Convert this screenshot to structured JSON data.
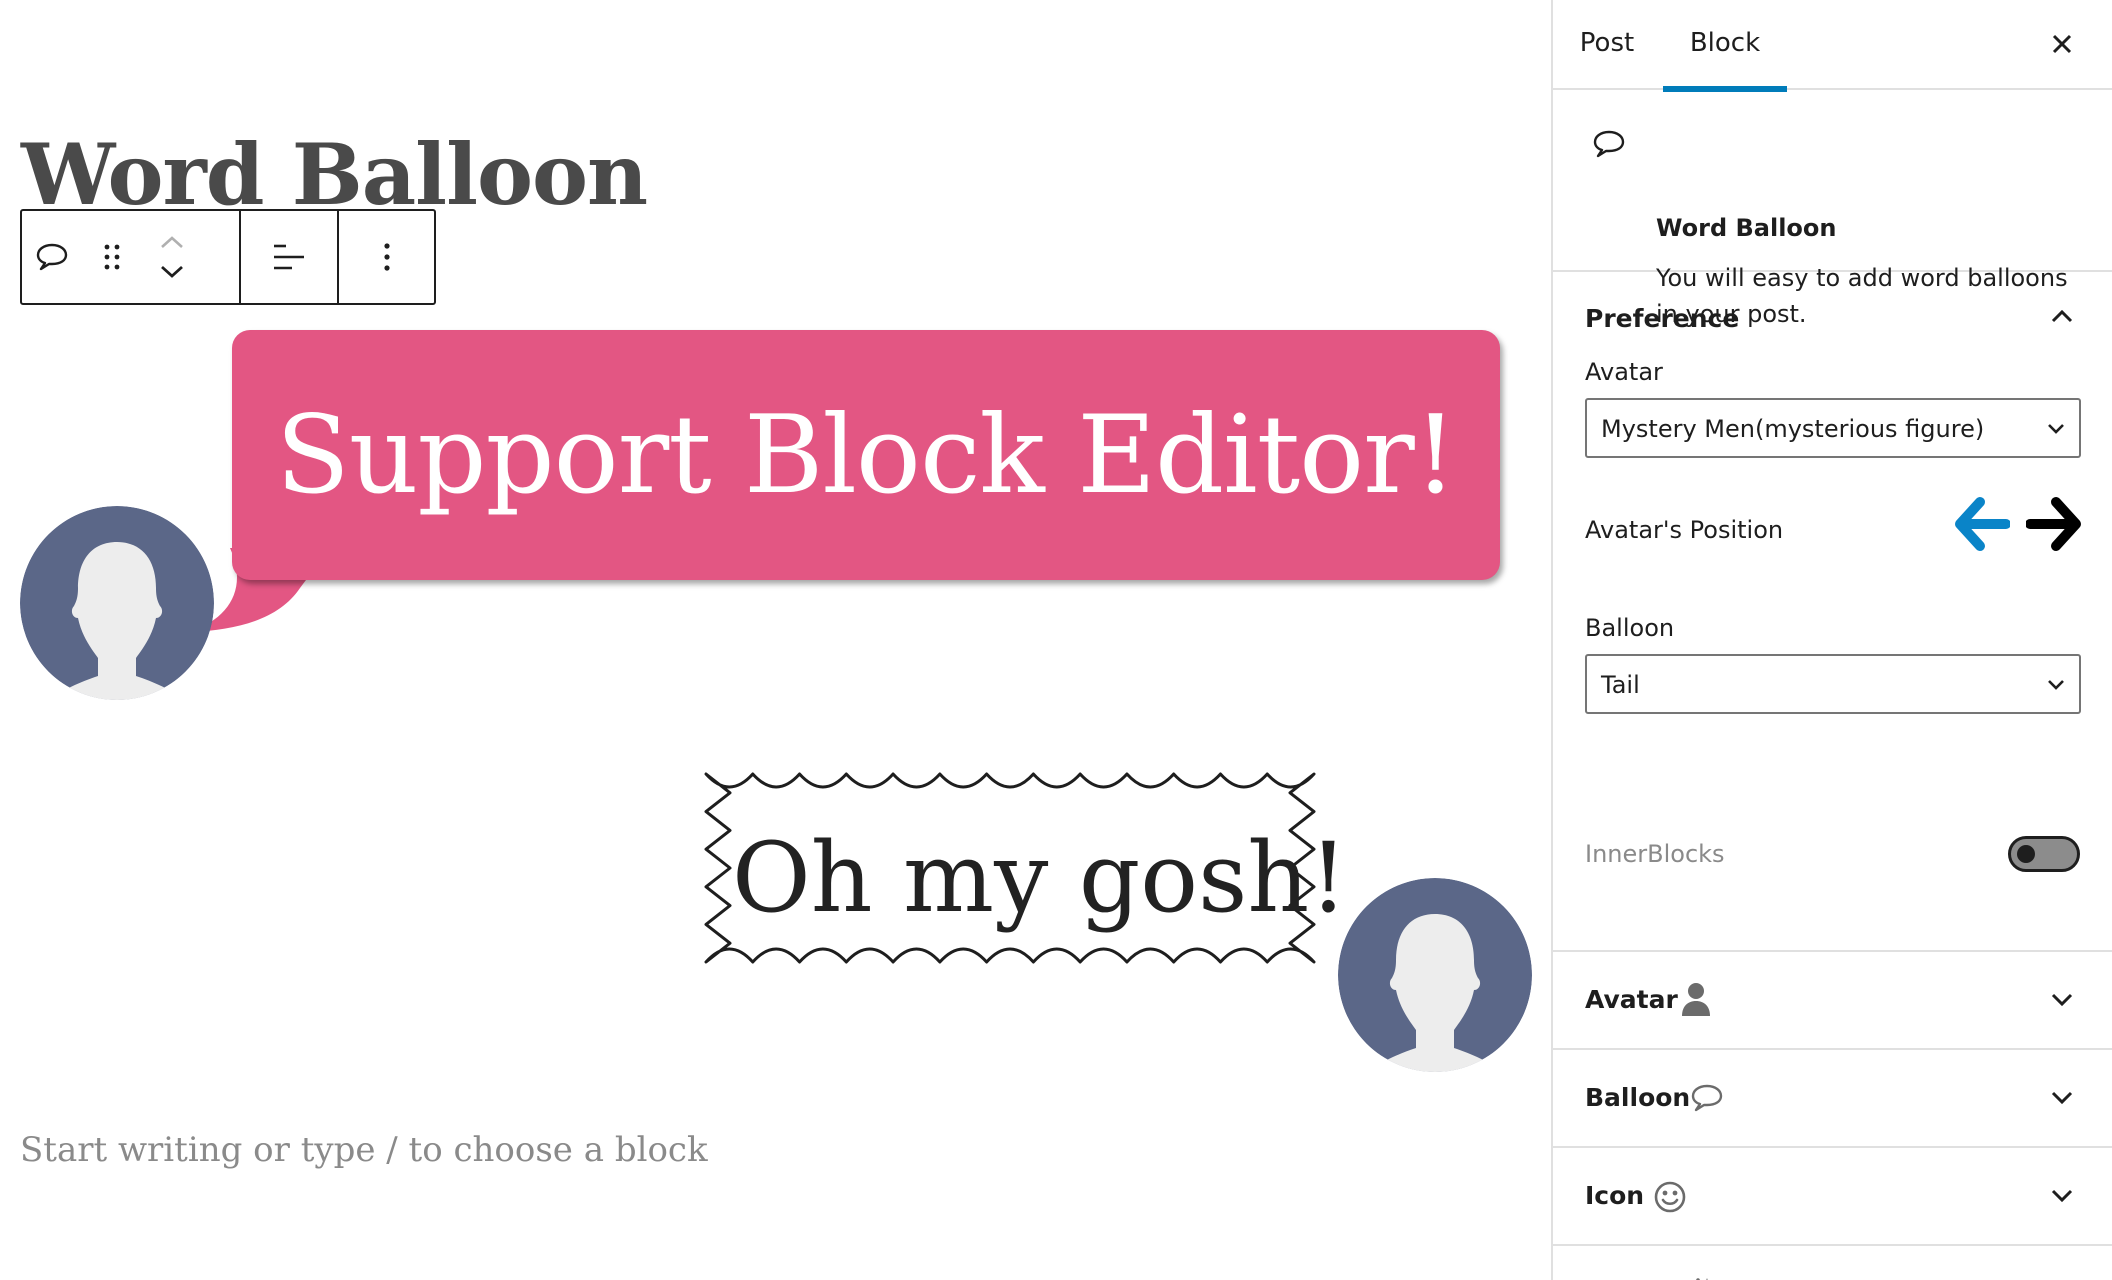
{
  "post": {
    "title": "Word Balloon",
    "appender_placeholder": "Start writing or type / to choose a block"
  },
  "balloons": [
    {
      "text": "Support Block Editor!",
      "type": "Tail",
      "color": "#e35683",
      "avatar_side": "left"
    },
    {
      "text": "Oh my gosh!",
      "type": "spiky",
      "avatar_side": "right"
    }
  ],
  "toolbar": {
    "buttons": [
      "speech-bubble-icon",
      "drag-handle-icon",
      "move-up-icon",
      "move-down-icon",
      "align-icon",
      "more-options-icon"
    ]
  },
  "sidebar": {
    "tabs": [
      {
        "label": "Post",
        "active": false
      },
      {
        "label": "Block",
        "active": true
      }
    ],
    "block_card": {
      "title": "Word Balloon",
      "description": "You will easy to add word balloons in your post."
    },
    "preference": {
      "title": "Preference",
      "expanded": true,
      "avatar_label": "Avatar",
      "avatar_value": "Mystery Men(mysterious figure)",
      "position_label": "Avatar's Position",
      "balloon_label": "Balloon",
      "balloon_value": "Tail",
      "innerblocks_label": "InnerBlocks",
      "innerblocks_on": false
    },
    "panels": [
      {
        "title": "Avatar",
        "icon": "person-icon"
      },
      {
        "title": "Balloon",
        "icon": "speech-bubble-icon"
      },
      {
        "title": "Icon",
        "icon": "smiley-icon"
      },
      {
        "title": "Effects",
        "icon": "magic-wand-icon"
      }
    ],
    "accent_color": "#007cba",
    "arrow_left_color": "#0a84c8"
  }
}
